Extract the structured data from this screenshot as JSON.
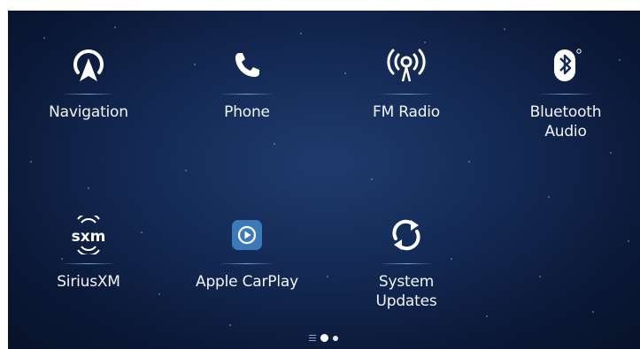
{
  "tiles": [
    {
      "label": "Navigation",
      "icon": "navigation-icon"
    },
    {
      "label": "Phone",
      "icon": "phone-icon"
    },
    {
      "label": "FM Radio",
      "icon": "fm-radio-icon"
    },
    {
      "label": "Bluetooth\nAudio",
      "icon": "bluetooth-audio-icon"
    },
    {
      "label": "SiriusXM",
      "icon": "siriusxm-icon",
      "logo_text": "sxm"
    },
    {
      "label": "Apple CarPlay",
      "icon": "apple-carplay-icon"
    },
    {
      "label": "System\nUpdates",
      "icon": "system-updates-icon"
    }
  ],
  "pager": {
    "page_count": 2,
    "current_page": 1
  },
  "colors": {
    "background_center": "#1f3b6d",
    "background_edge": "#081229",
    "icon_white": "#ffffff",
    "carplay_tile": "#3b79b8",
    "divider_blue": "#6fa6e0"
  }
}
